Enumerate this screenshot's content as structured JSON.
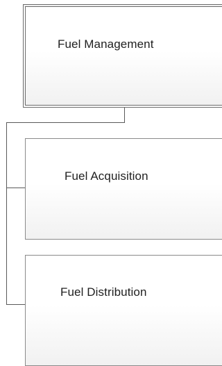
{
  "diagram": {
    "root": {
      "label": "Fuel Management"
    },
    "children": [
      {
        "label": "Fuel Acquisition"
      },
      {
        "label": "Fuel Distribution"
      }
    ]
  },
  "colors": {
    "box_border": "#6b6b6b",
    "connector": "#595959",
    "text": "#1f1f1f"
  }
}
